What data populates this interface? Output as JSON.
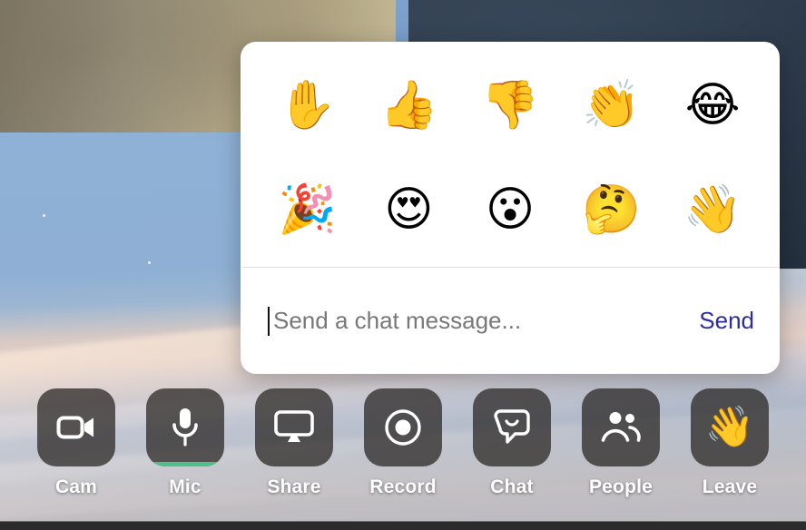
{
  "app": {
    "name": "video-meeting",
    "accent_send": "#2d2d9c",
    "mic_level_color": "#4fbf8b",
    "panel_background": "#ffffff"
  },
  "stage": {
    "tiles": [
      {
        "name": "participant-tile-tan",
        "color": "#a59b7f"
      },
      {
        "name": "participant-tile-slate",
        "color": "#2e3d50"
      },
      {
        "name": "participant-tile-snow",
        "color": "#8fb1d6"
      }
    ]
  },
  "reactions_panel": {
    "emojis": [
      {
        "glyph": "✋",
        "name": "raised-hand-emoji",
        "label": "Raise hand"
      },
      {
        "glyph": "👍",
        "name": "thumbs-up-emoji",
        "label": "Thumbs up"
      },
      {
        "glyph": "👎",
        "name": "thumbs-down-emoji",
        "label": "Thumbs down"
      },
      {
        "glyph": "👏",
        "name": "clapping-hands-emoji",
        "label": "Clap"
      },
      {
        "glyph": "😂",
        "name": "tears-of-joy-emoji",
        "label": "Laugh"
      },
      {
        "glyph": "🎉",
        "name": "party-popper-emoji",
        "label": "Celebrate"
      },
      {
        "glyph": "😍",
        "name": "heart-eyes-emoji",
        "label": "Love"
      },
      {
        "glyph": "😮",
        "name": "open-mouth-emoji",
        "label": "Surprised"
      },
      {
        "glyph": "🤔",
        "name": "thinking-face-emoji",
        "label": "Thinking"
      },
      {
        "glyph": "👋",
        "name": "waving-hand-emoji",
        "label": "Wave"
      }
    ]
  },
  "chat": {
    "input_value": "",
    "placeholder": "Send a chat message...",
    "send_label": "Send"
  },
  "toolbar": {
    "items": [
      {
        "label": "Cam",
        "icon": "video-camera-icon",
        "active_indicator": false
      },
      {
        "label": "Mic",
        "icon": "microphone-icon",
        "active_indicator": true
      },
      {
        "label": "Share",
        "icon": "screen-share-icon",
        "active_indicator": false
      },
      {
        "label": "Record",
        "icon": "record-icon",
        "active_indicator": false
      },
      {
        "label": "Chat",
        "icon": "chat-bubble-icon",
        "active_indicator": false
      },
      {
        "label": "People",
        "icon": "people-icon",
        "active_indicator": false
      },
      {
        "label": "Leave",
        "icon": "waving-hand-icon",
        "active_indicator": false
      }
    ]
  }
}
